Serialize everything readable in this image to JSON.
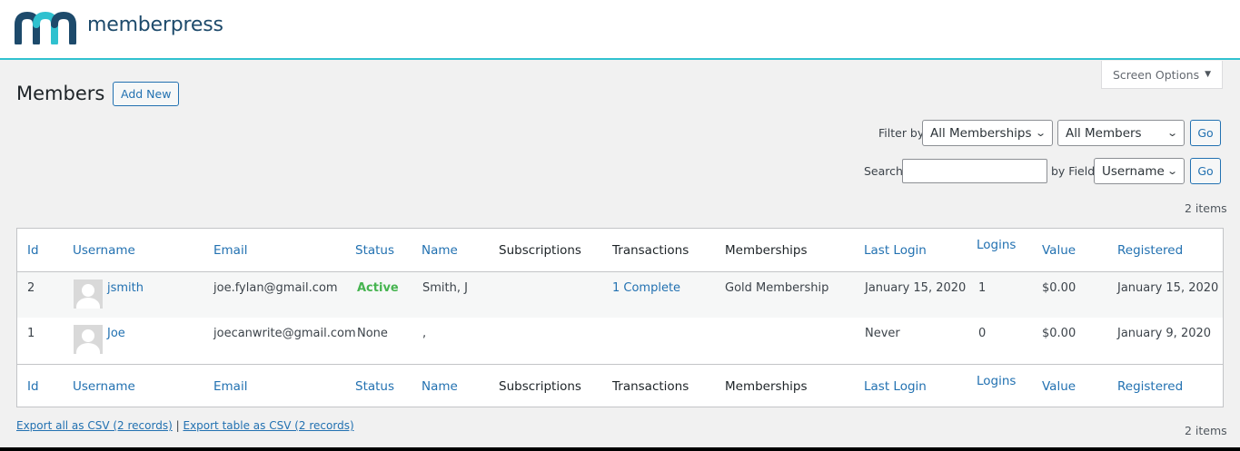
{
  "brand": {
    "name": "memberpress",
    "colors": {
      "teal": "#2fc1cf",
      "navy": "#1d4a6b"
    }
  },
  "screen_options": {
    "label": "Screen Options",
    "caret": "▼"
  },
  "page": {
    "title": "Members",
    "add_new": "Add New"
  },
  "filters": {
    "filter_by_label": "Filter by",
    "memberships_select": "All Memberships",
    "members_select": "All Members",
    "go": "Go",
    "search_label": "Search",
    "search_value": "",
    "by_field_label": "by Field",
    "field_select": "Username",
    "items_count_top": "2 items"
  },
  "table": {
    "columns": [
      "Id",
      "Username",
      "Email",
      "Status",
      "Name",
      "Subscriptions",
      "Transactions",
      "Memberships",
      "Last Login",
      "Logins",
      "Value",
      "Registered"
    ],
    "rows": [
      {
        "id": "2",
        "username": "jsmith",
        "email": "joe.fylan@gmail.com",
        "status": "Active",
        "name": "Smith, J",
        "subscriptions": "",
        "transactions": "1 Complete",
        "memberships": "Gold Membership",
        "last_login": "January 15, 2020",
        "logins": "1",
        "value": "$0.00",
        "registered": "January 15, 2020"
      },
      {
        "id": "1",
        "username": "Joe",
        "email": "joecanwrite@gmail.com",
        "status": "None",
        "name": ",",
        "subscriptions": "",
        "transactions": "",
        "memberships": "",
        "last_login": "Never",
        "logins": "0",
        "value": "$0.00",
        "registered": "January 9, 2020"
      }
    ]
  },
  "footer": {
    "export_all": "Export all as CSV (2 records)",
    "separator": "|",
    "export_table": "Export table as CSV (2 records)",
    "items_count_bottom": "2 items"
  }
}
